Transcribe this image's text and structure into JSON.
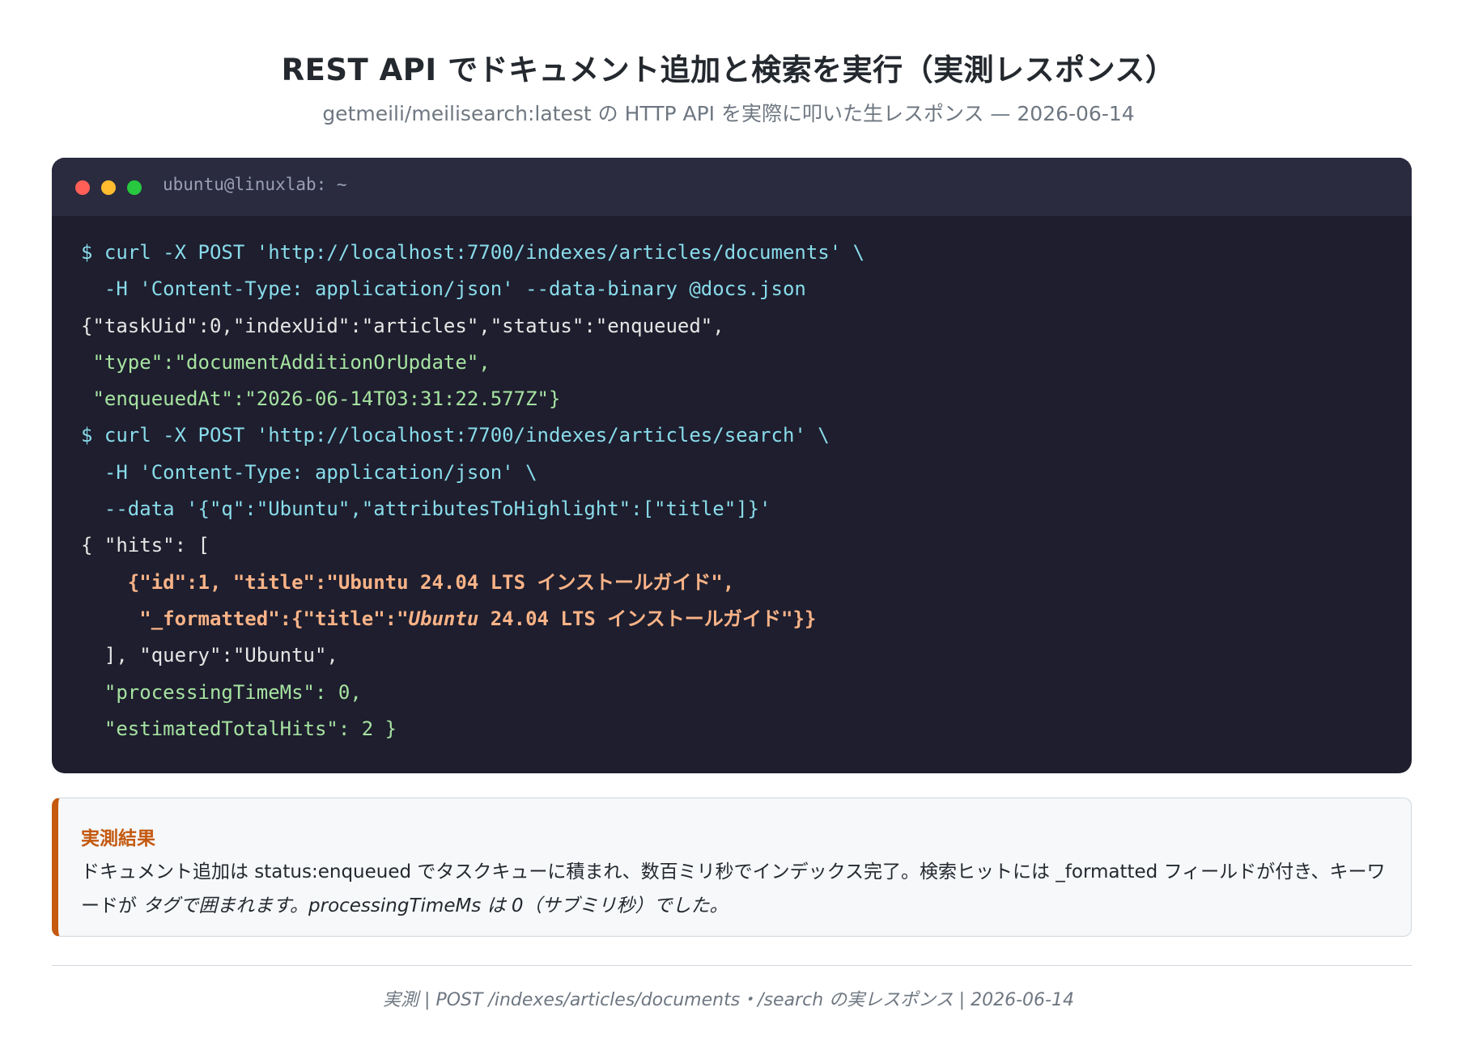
{
  "page": {
    "title": "REST API でドキュメント追加と検索を実行（実測レスポンス）",
    "subtitle": "getmeili/meilisearch:latest の HTTP API を実際に叩いた生レスポンス — 2026-06-14"
  },
  "terminal": {
    "title": "ubuntu@linuxlab: ~",
    "lines": {
      "l1": "$ curl -X POST 'http://localhost:7700/indexes/articles/documents' \\",
      "l2": "  -H 'Content-Type: application/json' --data-binary @docs.json",
      "l3": "{\"taskUid\":0,\"indexUid\":\"articles\",\"status\":\"enqueued\",",
      "l4": " \"type\":\"documentAdditionOrUpdate\",",
      "l5": " \"enqueuedAt\":\"2026-06-14T03:31:22.577Z\"}",
      "l6": "$ curl -X POST 'http://localhost:7700/indexes/articles/search' \\",
      "l7": "  -H 'Content-Type: application/json' \\",
      "l8": "  --data '{\"q\":\"Ubuntu\",\"attributesToHighlight\":[\"title\"]}'",
      "l9": "{ \"hits\": [",
      "l10": "    {\"id\":1, \"title\":\"Ubuntu 24.04 LTS インストールガイド\",",
      "l11a": "     \"_formatted\":{\"title\":\"",
      "l11b": "Ubuntu",
      "l11c": " 24.04 LTS インストールガイド\"}}",
      "l12": "  ], \"query\":\"Ubuntu\",",
      "l13": "  \"processingTimeMs\": 0,",
      "l14": "  \"estimatedTotalHits\": 2 }"
    }
  },
  "note": {
    "title": "実測結果",
    "text_a": "ドキュメント追加は status:enqueued でタスクキューに積まれ、数百ミリ秒でインデックス完了。検索ヒットには _formatted フィールドが付き、キーワードが ",
    "text_b": "タグで囲まれます。processingTimeMs は 0（サブミリ秒）でした。"
  },
  "footer": {
    "text": "実測 | POST /indexes/articles/documents・/search の実レスポンス | 2026-06-14"
  },
  "colors": {
    "terminal_bg": "#1e1e2e",
    "command": "#89dceb",
    "string": "#a6e3a1",
    "highlight": "#fab387",
    "accent": "#c4590f"
  }
}
